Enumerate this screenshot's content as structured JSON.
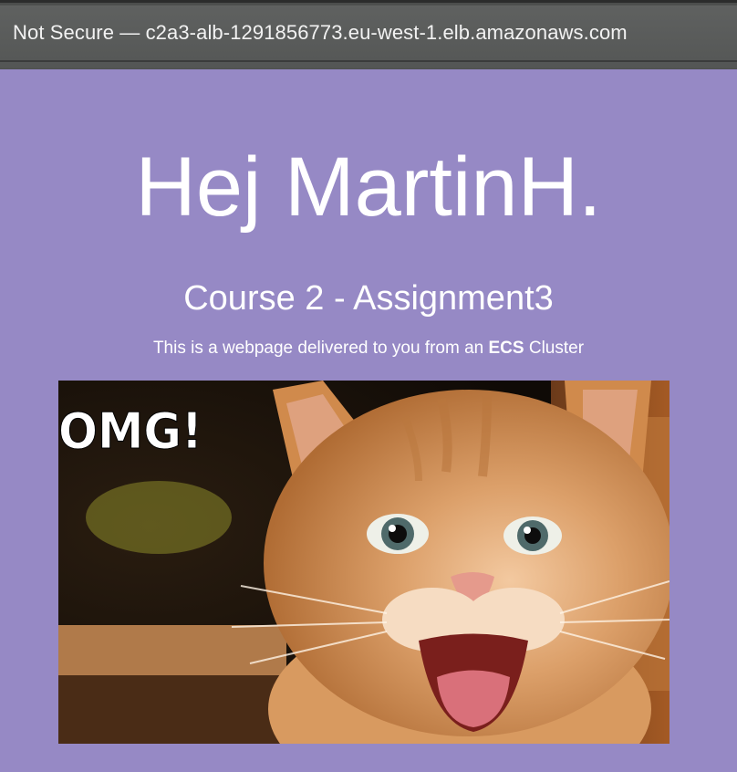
{
  "titlebar": {
    "text": "Not Secure — c2a3-alb-1291856773.eu-west-1.elb.amazonaws.com"
  },
  "page": {
    "heading": "Hej MartinH.",
    "subheading": "Course 2 - Assignment3",
    "lead_prefix": "This is a webpage delivered to you from an ",
    "lead_bold": "ECS",
    "lead_suffix": " Cluster",
    "image_caption": "OMG!",
    "background_color": "#9689c5"
  }
}
